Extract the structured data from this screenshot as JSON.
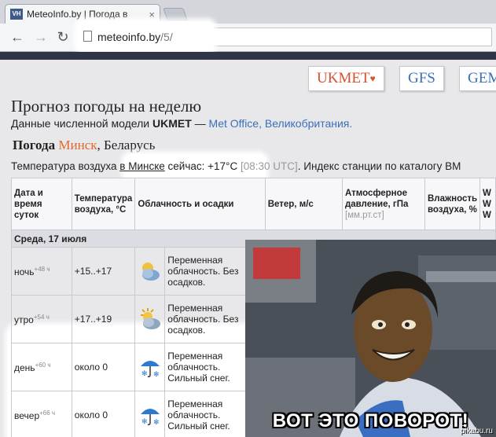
{
  "browser": {
    "tab_title": "MeteoInfo.by | Погода в",
    "tab_close": "×",
    "favicon_text": "VH",
    "url_host": "meteoinfo.by",
    "url_path": "/5/",
    "nav": {
      "back": "←",
      "forward": "→",
      "reload": "↻"
    }
  },
  "models": [
    "UKMET",
    "GFS",
    "GEM"
  ],
  "page": {
    "title": "Прогноз погоды на неделю",
    "subtitle_prefix": "Данные численной модели",
    "subtitle_model": "UKMET",
    "subtitle_dash": "—",
    "subtitle_source": "Met Office, Великобритания.",
    "location_prefix": "Погода",
    "location_city": "Минск",
    "location_country": ", Беларусь",
    "temp_prefix": "Температура воздуха",
    "temp_link": "в Минске",
    "temp_mid": "сейчас: +17°C",
    "temp_time": "[08:30 UTC]",
    "temp_suffix": ". Индекс станции по каталогу ВМ"
  },
  "table": {
    "headers": {
      "datetime": "Дата и время суток",
      "temp": "Температура воздуха, °С",
      "cloud": "Облачность и осадки",
      "wind": "Ветер, м/с",
      "pressure": "Атмосферное давление, гПа",
      "pressure_unit": "[мм.рт.ст]",
      "humidity": "Влажность воздуха, %",
      "extra": "W W W"
    },
    "date_row": "Среда, 17 июля",
    "rows": [
      {
        "time": "ночь",
        "hours": "+48 ч",
        "temp": "+15..+17",
        "icon": "partly-cloudy-night-icon",
        "desc": "Переменная облачность. Без осадков."
      },
      {
        "time": "утро",
        "hours": "+54 ч",
        "temp": "+17..+19",
        "icon": "partly-cloudy-day-icon",
        "desc": "Переменная облачность. Без осадков."
      },
      {
        "time": "день",
        "hours": "+60 ч",
        "temp": "около 0",
        "icon": "snow-umbrella-icon",
        "desc": "Переменная облачность. Сильный снег."
      },
      {
        "time": "вечер",
        "hours": "+66 ч",
        "temp": "около 0",
        "icon": "snow-umbrella-icon",
        "desc": "Переменная облачность. Сильный снег."
      }
    ]
  },
  "meme": {
    "caption": "ВОТ ЭТО ПОВОРОТ!",
    "watermark": "pikabu.ru"
  },
  "colors": {
    "accent_city": "#e06a2d",
    "link": "#3b6fb6",
    "ukmet": "#d9502f"
  }
}
